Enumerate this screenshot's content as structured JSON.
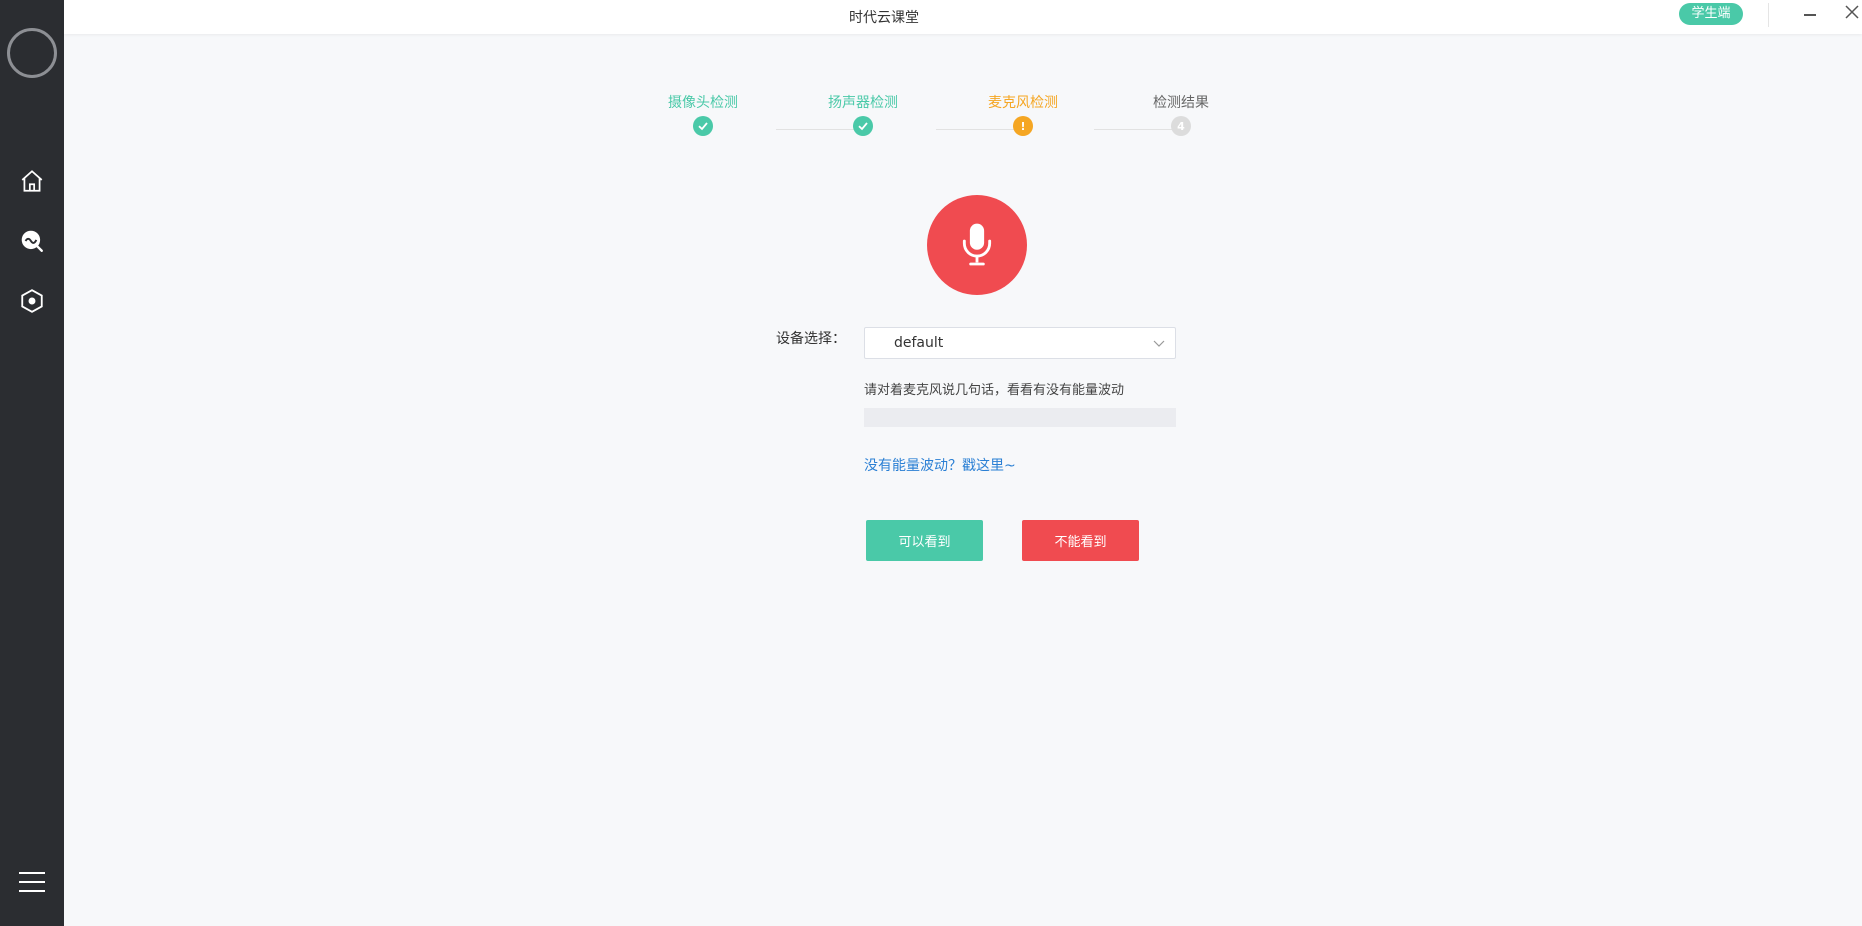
{
  "app": {
    "title": "时代云课堂",
    "role_badge": "学生端"
  },
  "colors": {
    "success": "#4ac9a8",
    "warning": "#f5a623",
    "pending": "#dcdcdc",
    "danger": "#f04b50",
    "link": "#2a7fd4",
    "sidebar": "#2b2d31"
  },
  "sidebar": {
    "items": [
      {
        "icon": "home-icon"
      },
      {
        "icon": "live-search-icon"
      },
      {
        "icon": "hexagon-settings-icon"
      }
    ],
    "menu_icon": "hamburger-menu-icon"
  },
  "steps": [
    {
      "label": "摄像头检测",
      "status": "done",
      "marker": ""
    },
    {
      "label": "扬声器检测",
      "status": "done",
      "marker": ""
    },
    {
      "label": "麦克风检测",
      "status": "active",
      "marker": "!"
    },
    {
      "label": "检测结果",
      "status": "pending",
      "marker": "4"
    }
  ],
  "mic": {
    "icon": "microphone-icon"
  },
  "device": {
    "label": "设备选择：",
    "value": "default"
  },
  "hint": "请对着麦克风说几句话，看看有没有能量波动",
  "energy_level": 0,
  "help_link": "没有能量波动？戳这里~",
  "actions": {
    "yes_label": "可以看到",
    "no_label": "不能看到"
  }
}
